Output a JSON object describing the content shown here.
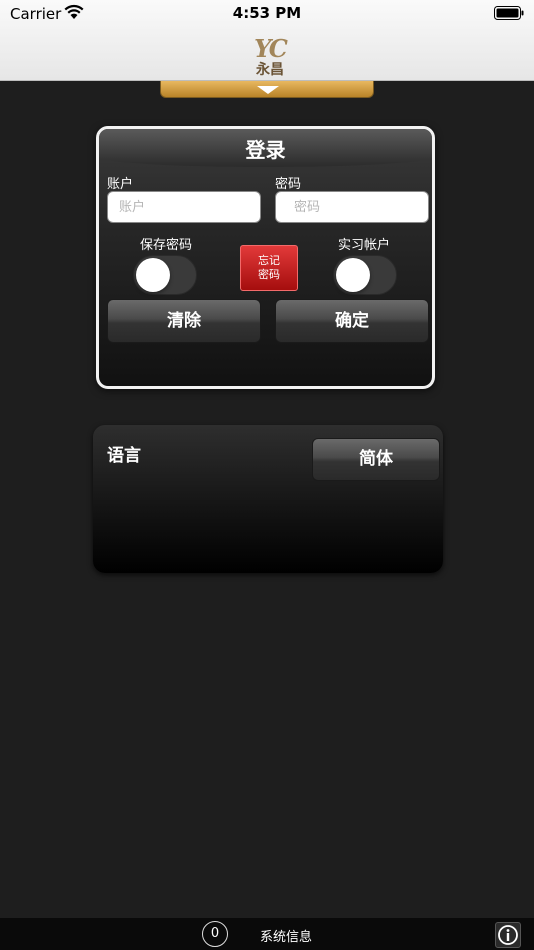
{
  "status_bar": {
    "carrier": "Carrier",
    "time": "4:53 PM"
  },
  "header": {
    "logo_mark": "YC",
    "logo_name": "永昌"
  },
  "login": {
    "title": "登录",
    "account_label": "账户",
    "account_placeholder": "账户",
    "account_value": "",
    "password_label": "密码",
    "password_placeholder": "密码",
    "password_value": "",
    "save_password_label": "保存密码",
    "save_password_on": false,
    "forgot_line1": "忘记",
    "forgot_line2": "密码",
    "demo_account_label": "实习帐户",
    "demo_account_on": false,
    "clear_label": "清除",
    "confirm_label": "确定"
  },
  "language": {
    "label": "语言",
    "selected": "简体"
  },
  "bottom_bar": {
    "message_count": "0",
    "system_info_label": "系统信息"
  },
  "colors": {
    "accent_gold": "#d9a548",
    "forgot_red": "#c91d1d",
    "background": "#1e1e1e"
  }
}
